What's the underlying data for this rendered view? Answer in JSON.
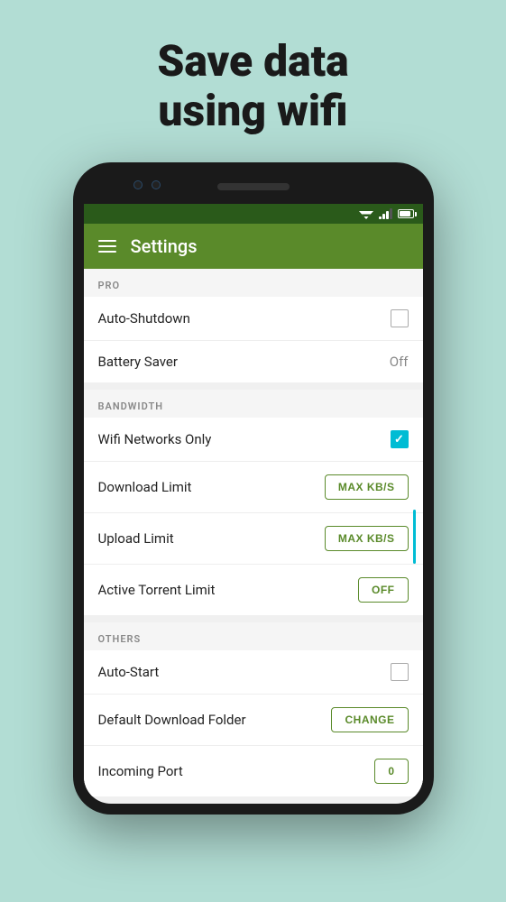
{
  "hero": {
    "line1": "Save data",
    "line2": "using wifi"
  },
  "statusBar": {
    "icons": [
      "wifi",
      "signal",
      "battery"
    ]
  },
  "appBar": {
    "title": "Settings"
  },
  "sections": [
    {
      "id": "pro",
      "header": "PRO",
      "rows": [
        {
          "label": "Auto-Shutdown",
          "control": "checkbox",
          "value": ""
        },
        {
          "label": "Battery Saver",
          "control": "text",
          "value": "Off"
        }
      ]
    },
    {
      "id": "bandwidth",
      "header": "BANDWIDTH",
      "rows": [
        {
          "label": "Wifi Networks Only",
          "control": "checkbox-checked",
          "value": ""
        },
        {
          "label": "Download Limit",
          "control": "button",
          "value": "MAX KB/S"
        },
        {
          "label": "Upload Limit",
          "control": "button",
          "value": "MAX KB/S"
        },
        {
          "label": "Active Torrent Limit",
          "control": "button",
          "value": "OFF"
        }
      ]
    },
    {
      "id": "others",
      "header": "OTHERS",
      "rows": [
        {
          "label": "Auto-Start",
          "control": "checkbox",
          "value": ""
        },
        {
          "label": "Default Download Folder",
          "control": "button",
          "value": "CHANGE"
        },
        {
          "label": "Incoming Port",
          "control": "button",
          "value": "0"
        }
      ]
    }
  ]
}
